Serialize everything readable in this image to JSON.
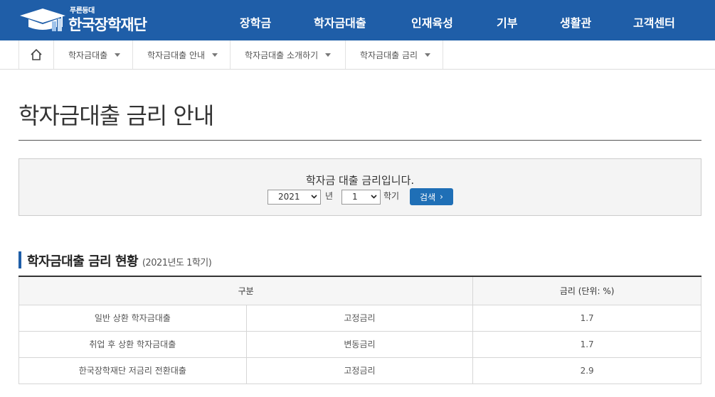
{
  "header": {
    "logo_small": "푸른등대",
    "logo_text": "한국장학재단",
    "nav": [
      "장학금",
      "학자금대출",
      "인재육성",
      "기부",
      "생활관",
      "고객센터"
    ]
  },
  "breadcrumb": {
    "items": [
      "학자금대출",
      "학자금대출 안내",
      "학자금대출 소개하기",
      "학자금대출 금리"
    ]
  },
  "page_title": "학자금대출 금리 안내",
  "search": {
    "caption": "학자금 대출 금리입니다.",
    "year_value": "2021",
    "year_label": "년",
    "term_value": "1",
    "term_label": "학기",
    "button_label": "검색",
    "button_chevron": "›"
  },
  "section": {
    "title": "학자금대출 금리 현황",
    "subtitle": "(2021년도 1학기)"
  },
  "table": {
    "headers": [
      "구분",
      "금리 (단위: %)"
    ],
    "rows": [
      [
        "일반 상환 학자금대출",
        "고정금리",
        "1.7"
      ],
      [
        "취업 후 상환 학자금대출",
        "변동금리",
        "1.7"
      ],
      [
        "한국장학재단 저금리 전환대출",
        "고정금리",
        "2.9"
      ]
    ]
  },
  "colors": {
    "header_bg": "#1f5ea8",
    "button_bg": "#1f6fb6"
  }
}
